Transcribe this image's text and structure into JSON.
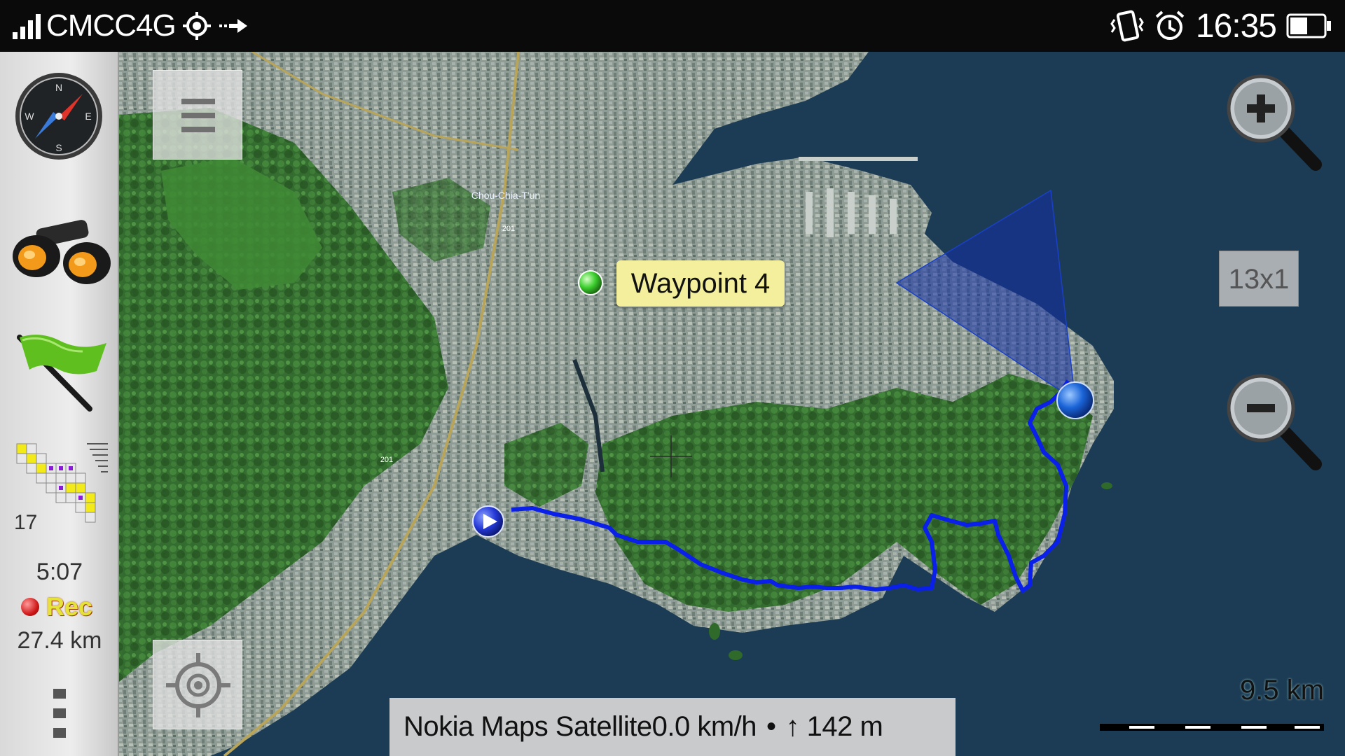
{
  "status_bar": {
    "carrier": "CMCC4G",
    "clock": "16:35",
    "icons": [
      "signal-icon",
      "gps-icon",
      "data-transfer-icon",
      "vibrate-icon",
      "alarm-icon",
      "battery-icon"
    ]
  },
  "sidebar": {
    "buttons": [
      "compass-icon",
      "binoculars-icon",
      "flag-icon",
      "satellites-icon",
      "more-menu-icon"
    ],
    "satellite_count": "17",
    "elapsed_time": "5:07",
    "rec_label": "Rec",
    "distance": "27.4 km"
  },
  "map": {
    "waypoint_label": "Waypoint 4",
    "place_label": "Chou-Chia-T'un",
    "road_labels": [
      "201",
      "201"
    ],
    "zoom_level_label": "13x1",
    "buttons": [
      "menu-icon",
      "center-location-icon",
      "zoom-in-icon",
      "zoom-out-icon"
    ]
  },
  "info_bar": {
    "map_source": "Nokia Maps Satellite",
    "speed": "0.0 km/h",
    "separator": "•",
    "altitude": "↑ 142 m"
  },
  "scale": {
    "label": "9.5 km"
  },
  "colors": {
    "track": "#0a20e8",
    "waypoint": "#3ccf2e",
    "position_marker": "#1a64d8",
    "sea": "#1c3b54",
    "forest": "#2f6e2a",
    "urban": "#8a9a92",
    "rec_text": "#e5e23a"
  }
}
